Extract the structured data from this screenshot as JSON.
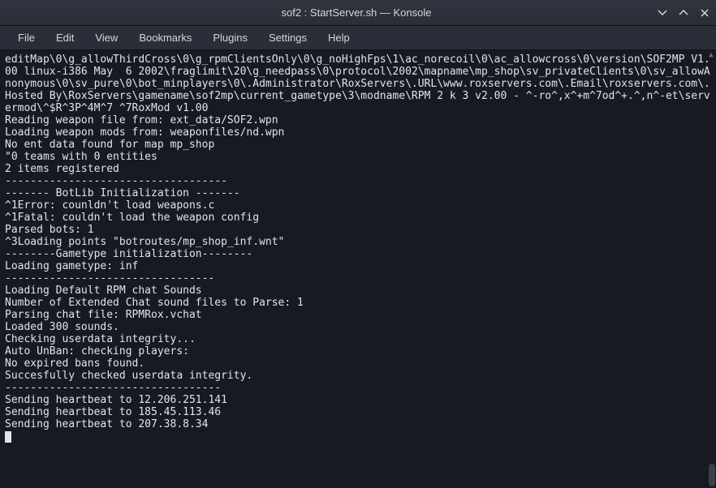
{
  "window": {
    "title": "sof2 : StartServer.sh — Konsole"
  },
  "menu": {
    "file": "File",
    "edit": "Edit",
    "view": "View",
    "bookmarks": "Bookmarks",
    "plugins": "Plugins",
    "settings": "Settings",
    "help": "Help"
  },
  "terminal": {
    "lines": [
      "editMap\\0\\g_allowThirdCross\\0\\g_rpmClientsOnly\\0\\g_noHighFps\\1\\ac_norecoil\\0\\ac_allowcross\\0\\version\\SOF2MP V1.00 linux-i386 May  6 2002\\fraglimit\\20\\g_needpass\\0\\protocol\\2002\\mapname\\mp_shop\\sv_privateClients\\0\\sv_allowAnonymous\\0\\sv_pure\\0\\bot_minplayers\\0\\.Administrator\\RoxServers\\.URL\\www.roxservers.com\\.Email\\roxservers.com\\.Hosted By\\RoxServers\\gamename\\sof2mp\\current_gametype\\3\\modname\\RPM 2 k 3 v2.00 - ^-ro^,x^+m^7od^+.^,n^-et\\servermod\\^$R^3P^4M^7 ^7RoxMod v1.00",
      "Reading weapon file from: ext_data/SOF2.wpn",
      "Loading weapon mods from: weaponfiles/nd.wpn",
      "No ent data found for map mp_shop",
      "\"0 teams with 0 entities",
      "2 items registered",
      "-----------------------------------",
      "------- BotLib Initialization -------",
      "^1Error: counldn't load weapons.c",
      "^1Fatal: couldn't load the weapon config",
      "Parsed bots: 1",
      "^3Loading points \"botroutes/mp_shop_inf.wnt\"",
      "--------Gametype initialization--------",
      "Loading gametype: inf",
      "---------------------------------",
      "Loading Default RPM chat Sounds",
      "Number of Extended Chat sound files to Parse: 1",
      "Parsing chat file: RPMRox.vchat",
      "Loaded 300 sounds.",
      "Checking userdata integrity...",
      "Auto UnBan: checking players:",
      "No expired bans found.",
      "Succesfully checked userdata integrity.",
      "----------------------------------",
      "Sending heartbeat to 12.206.251.141",
      "Sending heartbeat to 185.45.113.46",
      "Sending heartbeat to 207.38.8.34"
    ]
  }
}
